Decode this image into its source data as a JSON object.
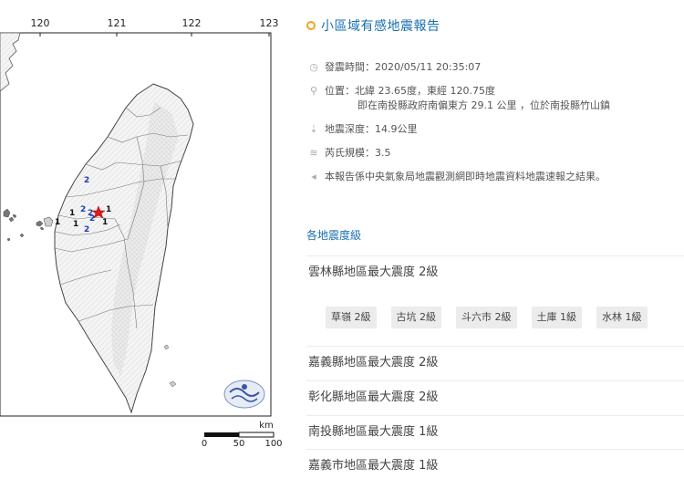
{
  "map": {
    "longitudes": [
      "120",
      "121",
      "122",
      "123"
    ],
    "scale_unit": "km",
    "scale_ticks": [
      "0",
      "50",
      "100"
    ],
    "epicenter_marker": "red-star",
    "intensity_labels": [
      {
        "value": "2",
        "color": "#1a3fb0"
      },
      {
        "value": "2",
        "color": "#1a3fb0"
      },
      {
        "value": "1",
        "color": "#111111"
      },
      {
        "value": "2",
        "color": "#1a3fb0"
      },
      {
        "value": "2",
        "color": "#1a3fb0"
      },
      {
        "value": "1",
        "color": "#111111"
      },
      {
        "value": "1",
        "color": "#111111"
      },
      {
        "value": "2",
        "color": "#1a3fb0"
      },
      {
        "value": "1",
        "color": "#111111"
      },
      {
        "value": "1",
        "color": "#111111"
      }
    ],
    "logo": "cwb-logo"
  },
  "report": {
    "title": "小區域有感地震報告",
    "time": "發震時間：2020/05/11 20:35:07",
    "location_line1": "位置：北緯 23.65度，東經 120.75度",
    "location_line2": "即在南投縣政府南偏東方 29.1 公里 ，位於南投縣竹山鎮",
    "depth": "地震深度：14.9公里",
    "magnitude": "芮氏規模：3.5",
    "note": "本報告係中央氣象局地震觀測網即時地震資料地震速報之結果。",
    "intensity_link": "各地震度級",
    "counties": [
      {
        "label": "雲林縣地區最大震度 2級"
      },
      {
        "label": "嘉義縣地區最大震度 2級"
      },
      {
        "label": "彰化縣地區最大震度 2級"
      },
      {
        "label": "南投縣地區最大震度 1級"
      },
      {
        "label": "嘉義市地區最大震度 1級"
      }
    ],
    "stations": [
      "草嶺 2級",
      "古坑 2級",
      "斗六市 2級",
      "土庫 1級",
      "水林 1級"
    ]
  },
  "colors": {
    "accent": "#1a6faf",
    "title_dot": "#f2a51a",
    "epicenter": "#e01818"
  },
  "icons": {
    "time": "clock-icon",
    "location": "pin-icon",
    "depth": "arrow-down-icon",
    "magnitude": "wave-icon",
    "note": "megaphone-icon"
  }
}
